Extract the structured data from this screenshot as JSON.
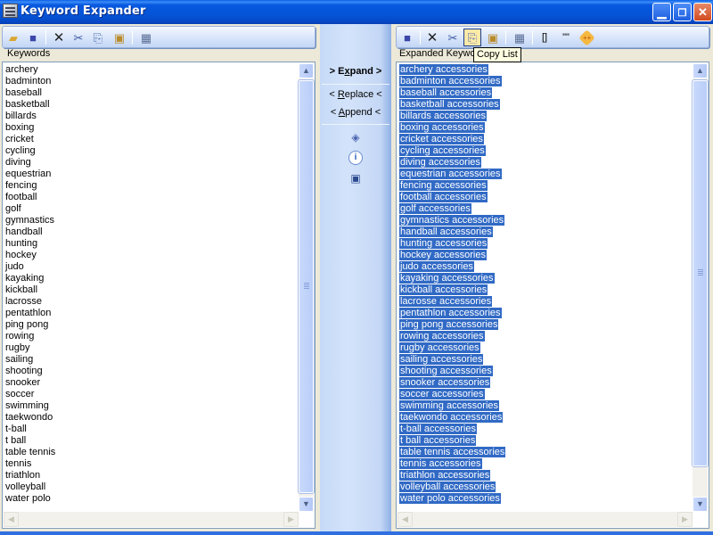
{
  "window": {
    "title": "Keyword Expander",
    "controls": {
      "minimize": "_",
      "restore": "❐",
      "close": "✕"
    }
  },
  "left_panel": {
    "toolbar": [
      {
        "name": "open-icon",
        "glyph": "📂"
      },
      {
        "name": "save-icon",
        "glyph": "💾"
      },
      {
        "name": "delete-icon",
        "glyph": "✕"
      },
      {
        "name": "cut-icon",
        "glyph": "✂"
      },
      {
        "name": "copy-icon",
        "glyph": "⎘"
      },
      {
        "name": "paste-icon",
        "glyph": "📋"
      },
      {
        "name": "calculator-icon",
        "glyph": "▦"
      }
    ],
    "label": "Keywords",
    "items": [
      "archery",
      "badminton",
      "baseball",
      "basketball",
      "billards",
      "boxing",
      "cricket",
      "cycling",
      "diving",
      "equestrian",
      "fencing",
      "football",
      "golf",
      "gymnastics",
      "handball",
      "hunting",
      "hockey",
      "judo",
      "kayaking",
      "kickball",
      "lacrosse",
      "pentathlon",
      "ping pong",
      "rowing",
      "rugby",
      "sailing",
      "shooting",
      "snooker",
      "soccer",
      "swimming",
      "taekwondo",
      "t-ball",
      "t ball",
      "table tennis",
      "tennis",
      "triathlon",
      "volleyball",
      "water polo"
    ]
  },
  "middle_panel": {
    "expand_label": "> Expand >",
    "expand_prefix": "> E",
    "expand_accel": "x",
    "expand_suffix": "pand >",
    "replace_prefix": "< ",
    "replace_accel": "R",
    "replace_suffix": "eplace <",
    "append_prefix": "< ",
    "append_accel": "A",
    "append_suffix": "ppend <",
    "icons": [
      "help-book-icon",
      "info-icon",
      "user-lock-icon"
    ]
  },
  "right_panel": {
    "toolbar": [
      {
        "name": "save-icon",
        "glyph": "💾"
      },
      {
        "name": "delete-icon",
        "glyph": "✕"
      },
      {
        "name": "cut-icon",
        "glyph": "✂"
      },
      {
        "name": "copy-list-icon",
        "glyph": "⎘"
      },
      {
        "name": "paste-icon",
        "glyph": "📋"
      },
      {
        "name": "calculator-icon",
        "glyph": "▦"
      },
      {
        "name": "brackets-icon",
        "glyph": "[]"
      },
      {
        "name": "quotes-icon",
        "glyph": "\"\""
      },
      {
        "name": "plus-plus-icon",
        "glyph": "++"
      }
    ],
    "label": "Expanded Keywords",
    "tooltip": "Copy List",
    "suffix": " accessories",
    "items": [
      "archery accessories",
      "badminton accessories",
      "baseball accessories",
      "basketball accessories",
      "billards accessories",
      "boxing accessories",
      "cricket accessories",
      "cycling accessories",
      "diving accessories",
      "equestrian accessories",
      "fencing accessories",
      "football accessories",
      "golf accessories",
      "gymnastics accessories",
      "handball accessories",
      "hunting accessories",
      "hockey accessories",
      "judo accessories",
      "kayaking accessories",
      "kickball accessories",
      "lacrosse accessories",
      "pentathlon accessories",
      "ping pong accessories",
      "rowing accessories",
      "rugby accessories",
      "sailing accessories",
      "shooting accessories",
      "snooker accessories",
      "soccer accessories",
      "swimming accessories",
      "taekwondo accessories",
      "t-ball accessories",
      "t ball accessories",
      "table tennis accessories",
      "tennis accessories",
      "triathlon accessories",
      "volleyball accessories",
      "water polo accessories"
    ]
  },
  "colors": {
    "selection": "#316ac5",
    "titlebar": "#0554d8",
    "tooltip_bg": "#ffffe1"
  }
}
